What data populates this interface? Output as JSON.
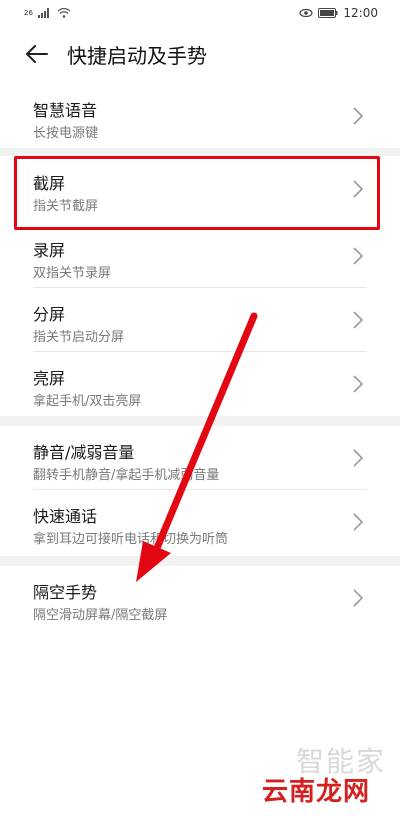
{
  "status_bar": {
    "signal": "26",
    "time": "12:00"
  },
  "header": {
    "title": "快捷启动及手势"
  },
  "groups": [
    {
      "items": [
        {
          "title": "智慧语音",
          "subtitle": "长按电源键"
        }
      ]
    },
    {
      "items": [
        {
          "title": "截屏",
          "subtitle": "指关节截屏"
        },
        {
          "title": "录屏",
          "subtitle": "双指关节录屏"
        },
        {
          "title": "分屏",
          "subtitle": "指关节启动分屏"
        },
        {
          "title": "亮屏",
          "subtitle": "拿起手机/双击亮屏"
        }
      ]
    },
    {
      "items": [
        {
          "title": "静音/减弱音量",
          "subtitle": "翻转手机静音/拿起手机减弱音量"
        },
        {
          "title": "快速通话",
          "subtitle": "拿到耳边可接听电话和切换为听筒"
        }
      ]
    },
    {
      "items": [
        {
          "title": "隔空手势",
          "subtitle": "隔空滑动屏幕/隔空截屏"
        }
      ]
    }
  ],
  "annotation": {
    "highlight_color": "#e30613",
    "arrow_color": "#e30613"
  },
  "watermark": {
    "top": "智能家",
    "bottom": "云南龙网"
  },
  "colors": {
    "background": "#ffffff",
    "section_gap": "#f2f2f2",
    "title_text": "#1a1a1a",
    "subtitle_text": "#7a7a7a"
  }
}
